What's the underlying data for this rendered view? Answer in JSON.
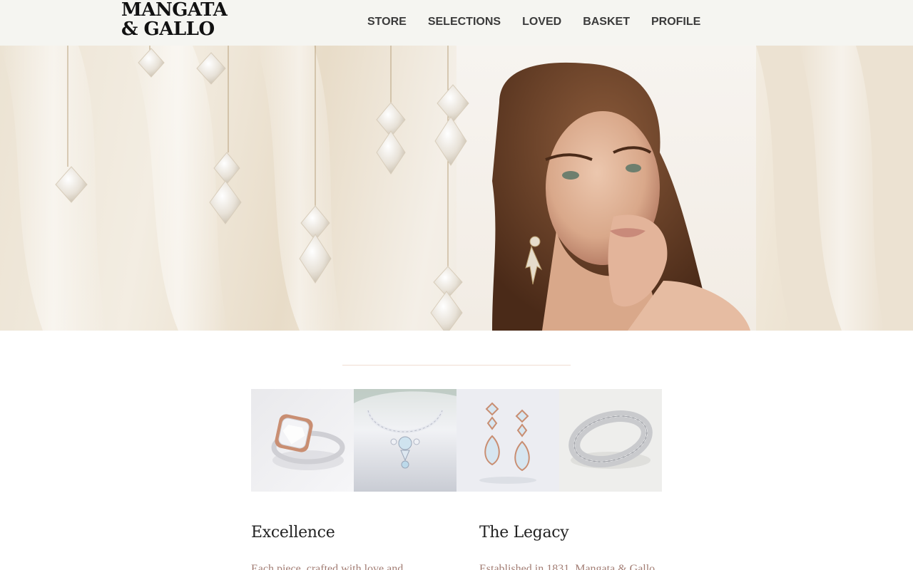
{
  "brand": {
    "line1": "MANGATA",
    "line2": "& GALLO"
  },
  "nav": {
    "items": [
      {
        "label": "STORE"
      },
      {
        "label": "SELECTIONS"
      },
      {
        "label": "LOVED"
      },
      {
        "label": "BASKET"
      },
      {
        "label": "PROFILE"
      }
    ]
  },
  "products": [
    {
      "icon": "ring-image"
    },
    {
      "icon": "necklace-image"
    },
    {
      "icon": "earrings-image"
    },
    {
      "icon": "bracelet-image"
    }
  ],
  "sections": {
    "excellence": {
      "title": "Excellence",
      "text": "Each piece, crafted with love and"
    },
    "legacy": {
      "title": "The Legacy",
      "text": "Established in 1831, Mangata & Gallo"
    }
  },
  "colors": {
    "header_bg": "#f5f5f1",
    "accent_text": "#a27d74",
    "divider": "#f0ddd2"
  }
}
